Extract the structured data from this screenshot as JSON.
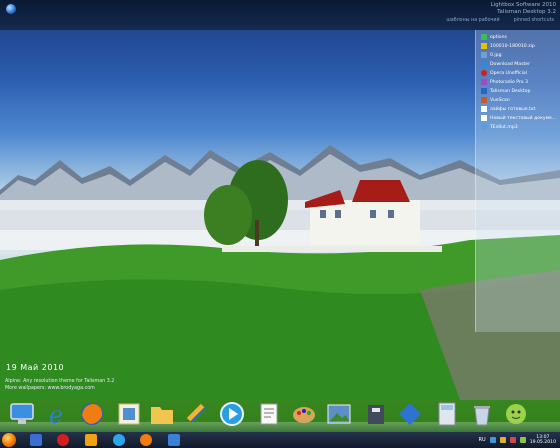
{
  "topbar": {
    "brand_line1": "Lightbox Software 2010",
    "brand_line2": "Talisman Desktop 3.2",
    "links": [
      "шаблоны на рабочий",
      "pinned shortcuts"
    ]
  },
  "panel": {
    "items": [
      {
        "label": "options",
        "color": "#3dbb58"
      },
      {
        "label": "100010-180010.zip",
        "color": "#e7c400"
      },
      {
        "label": "0.jpg",
        "color": "#6aa1d8"
      },
      {
        "label": "Download Master",
        "color": "#2f8ad8"
      },
      {
        "label": "Opera Unofficial",
        "color": "#d11f1f"
      },
      {
        "label": "Photoradio Pro 3",
        "color": "#a04ac4"
      },
      {
        "label": "Talisman Desktop",
        "color": "#2467c4"
      },
      {
        "label": "VueScan",
        "color": "#c45a24"
      },
      {
        "label": "лайфы готовые.txt",
        "color": "#ffffff"
      },
      {
        "label": "Новый текстовый докуме...",
        "color": "#ffffff"
      },
      {
        "label": "TEdilut.mp3",
        "color": "#5aa0e0"
      }
    ]
  },
  "date_text": "19  Май  2010",
  "caption": {
    "line1": "Alpine: Any resolution theme for Talisman 3.2",
    "line2": "More wallpapers: www.brodyaga.com"
  },
  "dock": {
    "icons": [
      "computer-icon",
      "internet-explorer-icon",
      "firefox-icon",
      "mail-stamp-icon",
      "folder-icon",
      "files-transfer-icon",
      "media-player-icon",
      "notepad-icon",
      "paint-palette-icon",
      "image-viewer-icon",
      "archive-icon",
      "diamond-icon",
      "calculator-icon",
      "recycle-bin-icon",
      "messenger-icon"
    ]
  },
  "taskbar": {
    "language": "RU",
    "clock_time": "13:07",
    "clock_date": "19.05.2010"
  }
}
